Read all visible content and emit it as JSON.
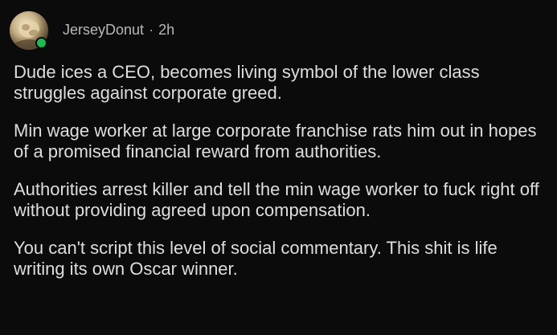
{
  "post": {
    "username": "JerseyDonut",
    "separator": "·",
    "time_ago": "2h",
    "avatar_icon": "user-avatar",
    "status_color": "#1fb954",
    "paragraphs": [
      "Dude ices a CEO, becomes living symbol of the lower class struggles against corporate greed.",
      "Min wage worker at large corporate franchise rats him out in hopes of a promised financial reward from authorities.",
      "Authorities arrest killer and tell the min wage worker to fuck right off without providing agreed upon compensation.",
      "You can't script this level of social commentary. This shit is life writing its own Oscar winner."
    ]
  }
}
